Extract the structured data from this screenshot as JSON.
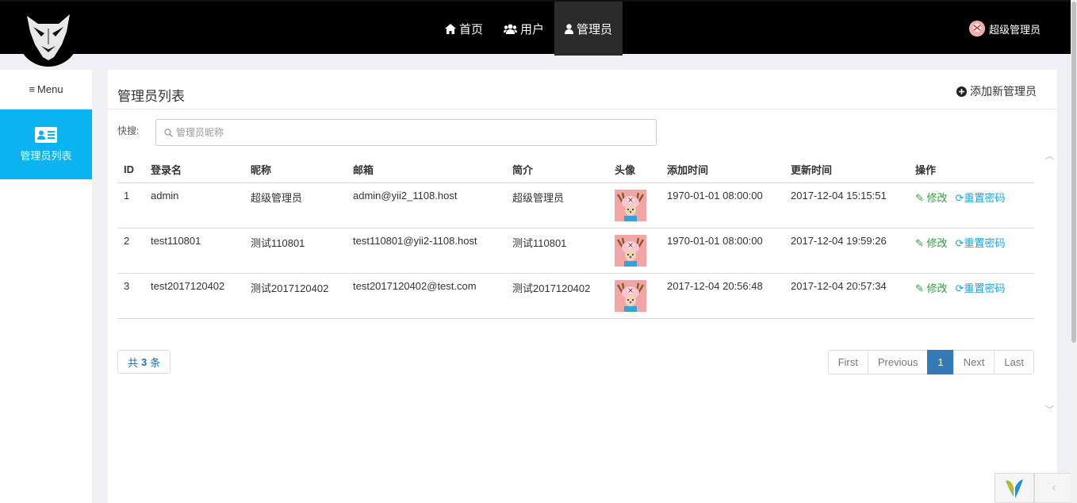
{
  "nav": {
    "home": "首页",
    "users": "用户",
    "admins": "管理员",
    "current_user": "超级管理员"
  },
  "sidebar": {
    "menu_label": "Menu",
    "items": [
      {
        "label": "管理员列表"
      }
    ]
  },
  "panel": {
    "title": "管理员列表",
    "add_label": "添加新管理员",
    "search_label": "快搜:",
    "search_placeholder": "管理员昵称"
  },
  "table": {
    "headers": [
      "ID",
      "登录名",
      "昵称",
      "邮箱",
      "简介",
      "头像",
      "添加时间",
      "更新时间",
      "操作"
    ],
    "rows": [
      {
        "id": "1",
        "login": "admin",
        "nickname": "超级管理员",
        "email": "admin@yii2_1108.host",
        "intro": "超级管理员",
        "created": "1970-01-01 08:00:00",
        "updated": "2017-12-04 15:15:51",
        "edit": "修改",
        "reset": "重置密码"
      },
      {
        "id": "2",
        "login": "test110801",
        "nickname": "测试110801",
        "email": "test110801@yii2-1108.host",
        "intro": "测试110801",
        "created": "1970-01-01 08:00:00",
        "updated": "2017-12-04 19:59:26",
        "edit": "修改",
        "reset": "重置密码"
      },
      {
        "id": "3",
        "login": "test2017120402",
        "nickname": "测试2017120402",
        "email": "test2017120402@test.com",
        "intro": "测试2017120402",
        "created": "2017-12-04 20:56:48",
        "updated": "2017-12-04 20:57:34",
        "edit": "修改",
        "reset": "重置密码"
      }
    ]
  },
  "summary": {
    "prefix": "共",
    "count": "3",
    "suffix": "条"
  },
  "pager": {
    "first": "First",
    "previous": "Previous",
    "current": "1",
    "next": "Next",
    "last": "Last"
  },
  "colors": {
    "accent": "#0bb3f0",
    "edit": "#2e9e3a",
    "reset": "#1aa3d9",
    "pager_active": "#337ab7"
  }
}
